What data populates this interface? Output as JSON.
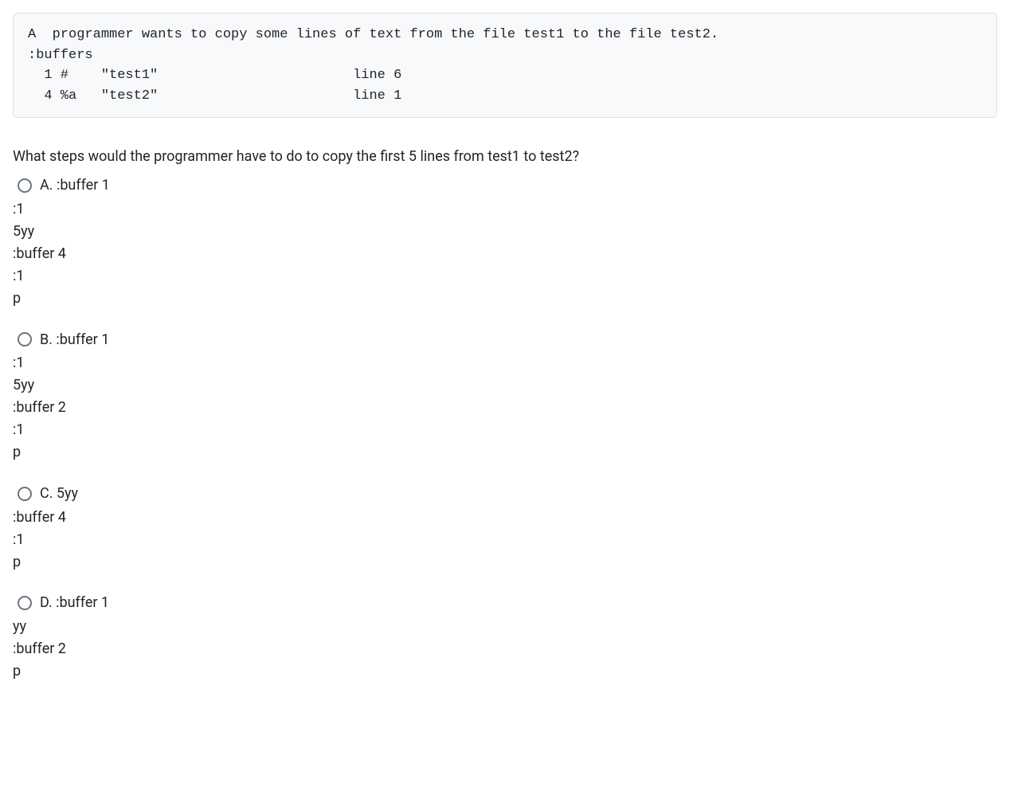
{
  "code_block": "A  programmer wants to copy some lines of text from the file test1 to the file test2.\n:buffers\n  1 #    \"test1\"                        line 6\n  4 %a   \"test2\"                        line 1",
  "question": "What steps would the programmer have to do to copy the first 5 lines from test1 to test2?",
  "options": {
    "a": {
      "first": "A. :buffer 1",
      "rest": ":1\n5yy\n:buffer 4\n:1\np"
    },
    "b": {
      "first": "B. :buffer 1",
      "rest": ":1\n5yy\n:buffer 2\n:1\np"
    },
    "c": {
      "first": "C. 5yy",
      "rest": ":buffer 4\n:1\np"
    },
    "d": {
      "first": "D. :buffer 1",
      "rest": "yy\n:buffer 2\np"
    }
  }
}
